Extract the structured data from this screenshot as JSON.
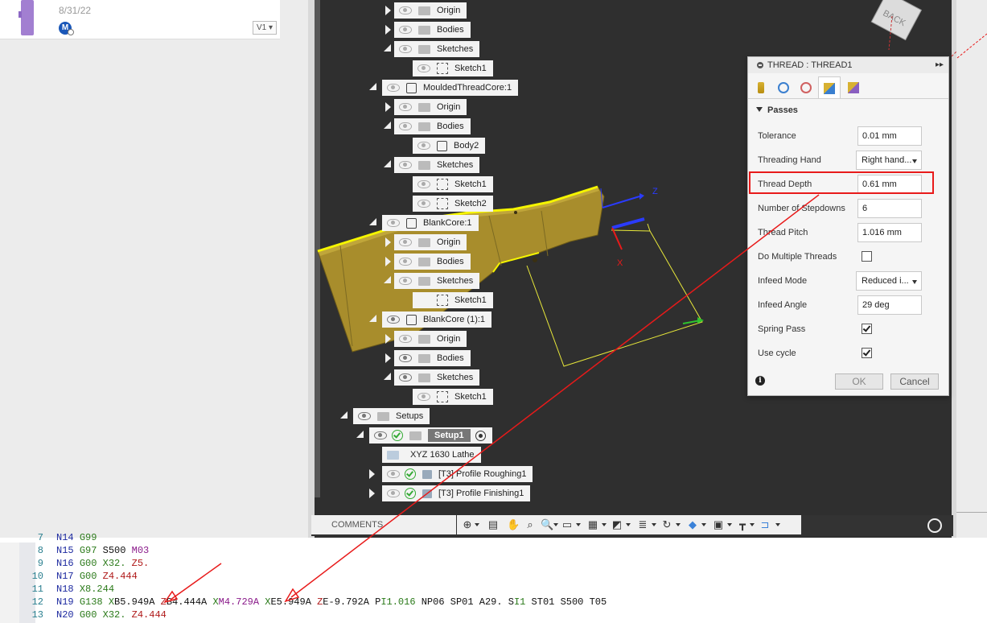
{
  "file": {
    "date": "8/31/22",
    "user_initial": "M",
    "version": "V1"
  },
  "tree": {
    "nodes": [
      {
        "label": "Origin"
      },
      {
        "label": "Bodies"
      },
      {
        "label": "Sketches"
      },
      {
        "label": "Sketch1"
      },
      {
        "label": "MouldedThreadCore:1"
      },
      {
        "label": "Origin"
      },
      {
        "label": "Bodies"
      },
      {
        "label": "Body2"
      },
      {
        "label": "Sketches"
      },
      {
        "label": "Sketch1"
      },
      {
        "label": "Sketch2"
      },
      {
        "label": "BlankCore:1"
      },
      {
        "label": "Origin"
      },
      {
        "label": "Bodies"
      },
      {
        "label": "Sketches"
      },
      {
        "label": "Sketch1"
      },
      {
        "label": "BlankCore (1):1"
      },
      {
        "label": "Origin"
      },
      {
        "label": "Bodies"
      },
      {
        "label": "Sketches"
      },
      {
        "label": "Sketch1"
      },
      {
        "label": "Setups"
      },
      {
        "label": "Setup1"
      },
      {
        "label": "XYZ 1630 Lathe"
      },
      {
        "label": "[T3] Profile Roughing1"
      },
      {
        "label": "[T3] Profile Finishing1"
      }
    ]
  },
  "viewport": {
    "back_label": "BACK",
    "axis_z": "Z",
    "axis_x": "X"
  },
  "thread_panel": {
    "title": "THREAD : THREAD1",
    "expand": "▸▸",
    "section": "Passes",
    "rows": [
      {
        "label": "Tolerance",
        "value": "0.01 mm",
        "kind": "input"
      },
      {
        "label": "Threading Hand",
        "value": "Right hand...",
        "kind": "dropdown"
      },
      {
        "label": "Thread Depth",
        "value": "0.61 mm",
        "kind": "input"
      },
      {
        "label": "Number of Stepdowns",
        "value": "6",
        "kind": "input"
      },
      {
        "label": "Thread Pitch",
        "value": "1.016 mm",
        "kind": "input"
      },
      {
        "label": "Do Multiple Threads",
        "checked": false,
        "kind": "checkbox"
      },
      {
        "label": "Infeed Mode",
        "value": "Reduced i...",
        "kind": "dropdown"
      },
      {
        "label": "Infeed Angle",
        "value": "29 deg",
        "kind": "input"
      },
      {
        "label": "Spring Pass",
        "checked": true,
        "kind": "checkbox"
      },
      {
        "label": "Use cycle",
        "checked": true,
        "kind": "checkbox"
      }
    ],
    "ok_label": "OK",
    "cancel_label": "Cancel",
    "info_label": "i"
  },
  "toolbar": {
    "comments_label": "COMMENTS"
  },
  "code": {
    "lines": [
      {
        "num": "7",
        "tokens": [
          [
            "n",
            "N14"
          ],
          [
            "k",
            " "
          ],
          [
            "g",
            "G99"
          ]
        ]
      },
      {
        "num": "8",
        "tokens": [
          [
            "n",
            "N15"
          ],
          [
            "k",
            " "
          ],
          [
            "g",
            "G97"
          ],
          [
            "k",
            " S500 "
          ],
          [
            "m",
            "M03"
          ]
        ]
      },
      {
        "num": "9",
        "tokens": [
          [
            "n",
            "N16"
          ],
          [
            "k",
            " "
          ],
          [
            "g",
            "G00"
          ],
          [
            "k",
            " "
          ],
          [
            "g",
            "X32."
          ],
          [
            "k",
            " "
          ],
          [
            "r",
            "Z5."
          ]
        ]
      },
      {
        "num": "10",
        "tokens": [
          [
            "n",
            "N17"
          ],
          [
            "k",
            " "
          ],
          [
            "g",
            "G00"
          ],
          [
            "k",
            " "
          ],
          [
            "r",
            "Z4.444"
          ]
        ]
      },
      {
        "num": "11",
        "tokens": [
          [
            "n",
            "N18"
          ],
          [
            "k",
            " "
          ],
          [
            "g",
            "X8.244"
          ]
        ]
      },
      {
        "num": "12",
        "tokens": [
          [
            "n",
            "N19"
          ],
          [
            "k",
            " "
          ],
          [
            "g",
            "G138"
          ],
          [
            "k",
            " "
          ],
          [
            "g",
            "X"
          ],
          [
            "k",
            "B5.949A "
          ],
          [
            "r",
            "Z"
          ],
          [
            "k",
            "B4.444A "
          ],
          [
            "g",
            "X"
          ],
          [
            "m",
            "M4.729A"
          ],
          [
            "k",
            " "
          ],
          [
            "g",
            "X"
          ],
          [
            "k",
            "E5.949A "
          ],
          [
            "r",
            "Z"
          ],
          [
            "k",
            "E-9.792A "
          ],
          [
            "k",
            "P"
          ],
          [
            "g",
            "I1.016"
          ],
          [
            "k",
            " NP06 SP01 A29. S"
          ],
          [
            "g",
            "I1"
          ],
          [
            "k",
            " ST01 S500 T05"
          ]
        ]
      },
      {
        "num": "13",
        "tokens": [
          [
            "n",
            "N20"
          ],
          [
            "k",
            " "
          ],
          [
            "g",
            "G00"
          ],
          [
            "k",
            " "
          ],
          [
            "g",
            "X32."
          ],
          [
            "k",
            " "
          ],
          [
            "r",
            "Z4.444"
          ]
        ]
      }
    ]
  },
  "colors": {
    "highlight_red": "#e81a1a",
    "body_gold": "#a88d2c",
    "selection_yellow": "#f5f500"
  }
}
